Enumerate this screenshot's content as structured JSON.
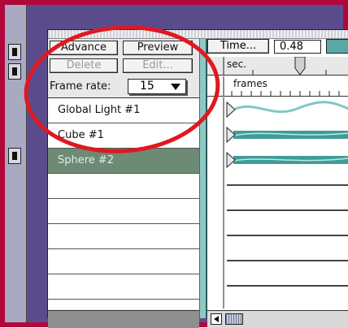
{
  "toolbar": {
    "advance_label": "Advance",
    "preview_label": "Preview",
    "delete_label": "Delete",
    "edit_label": "Edit...",
    "frame_rate_label": "Frame rate:",
    "frame_rate_value": "15"
  },
  "objects": [
    {
      "label": "Global Light #1",
      "selected": false
    },
    {
      "label": "Cube #1",
      "selected": false
    },
    {
      "label": "Sphere #2",
      "selected": true
    },
    {
      "label": "",
      "selected": false
    },
    {
      "label": "",
      "selected": false
    },
    {
      "label": "",
      "selected": false
    },
    {
      "label": "",
      "selected": false
    },
    {
      "label": "",
      "selected": false
    }
  ],
  "timeline": {
    "time_button_label": "Time...",
    "time_value": "0.48",
    "seconds_label": "sec.",
    "frames_label": "frames"
  },
  "colors": {
    "frame_border": "#b0083a",
    "selected_row": "#6c8a74",
    "teal_accent": "#5aa8a3",
    "annotation_oval": "#e01820"
  },
  "icons": {
    "popup_arrow": "triangle-down-icon",
    "keyframe_marker": "keyframe-icon",
    "scroll_left": "arrow-left-icon"
  }
}
